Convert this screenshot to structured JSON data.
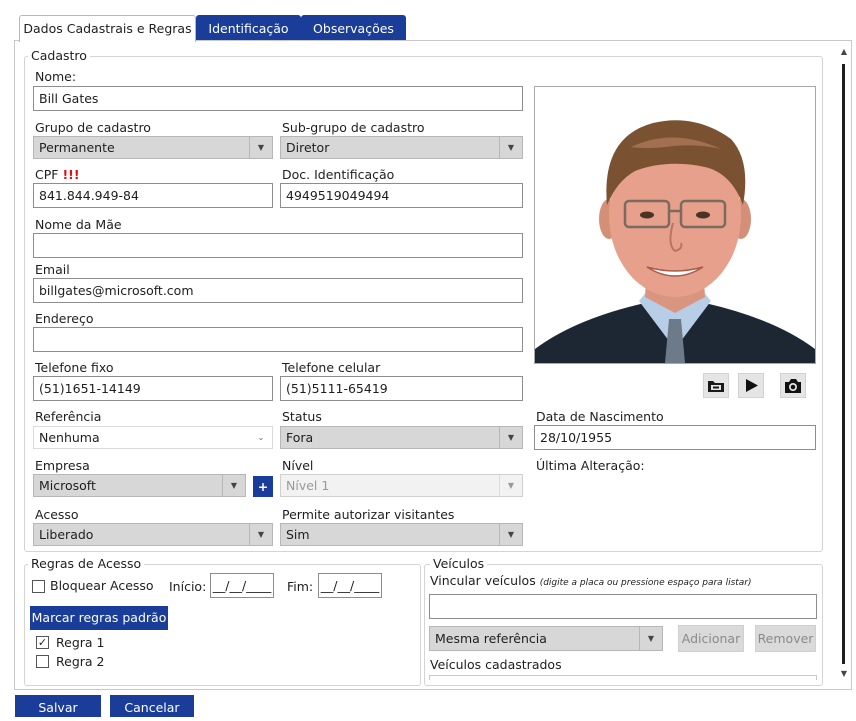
{
  "tabs": [
    {
      "label": "Dados Cadastrais e Regras",
      "active": true
    },
    {
      "label": "Identificação",
      "active": false
    },
    {
      "label": "Observações",
      "active": false
    }
  ],
  "cadastro": {
    "legend": "Cadastro",
    "nome": {
      "label": "Nome:",
      "value": "Bill Gates"
    },
    "grupo": {
      "label": "Grupo de cadastro",
      "value": "Permanente"
    },
    "subgrupo": {
      "label": "Sub-grupo de cadastro",
      "value": "Diretor"
    },
    "cpf": {
      "label": "CPF",
      "warning": "!!!",
      "value": "841.844.949-84"
    },
    "doc": {
      "label": "Doc. Identificação",
      "value": "4949519049494"
    },
    "mae": {
      "label": "Nome da Mãe",
      "value": ""
    },
    "email": {
      "label": "Email",
      "value": "billgates@microsoft.com"
    },
    "endereco": {
      "label": "Endereço",
      "value": ""
    },
    "tel_fixo": {
      "label": "Telefone fixo",
      "value": "(51)1651-14149"
    },
    "tel_cel": {
      "label": "Telefone celular",
      "value": "(51)5111-65419"
    },
    "referencia": {
      "label": "Referência",
      "value": "Nenhuma"
    },
    "status": {
      "label": "Status",
      "value": "Fora"
    },
    "empresa": {
      "label": "Empresa",
      "value": "Microsoft",
      "add_button": "+"
    },
    "nivel": {
      "label": "Nível",
      "value": "Nível 1"
    },
    "acesso": {
      "label": "Acesso",
      "value": "Liberado"
    },
    "visitantes": {
      "label": "Permite autorizar visitantes",
      "value": "Sim"
    },
    "nascimento": {
      "label": "Data de Nascimento",
      "value": "28/10/1955"
    },
    "ultima_alteracao": {
      "label": "Última Alteração:",
      "value": ""
    }
  },
  "photo_controls": [
    "open-folder-icon",
    "play-icon",
    "camera-icon"
  ],
  "regras": {
    "legend": "Regras de Acesso",
    "bloquear": {
      "label": "Bloquear Acesso",
      "checked": false
    },
    "inicio": {
      "label": "Início:",
      "value": "__/__/____"
    },
    "fim": {
      "label": "Fim:",
      "value": "__/__/____"
    },
    "marcar_button": "Marcar regras padrão",
    "items": [
      {
        "label": "Regra 1",
        "checked": true
      },
      {
        "label": "Regra 2",
        "checked": false
      }
    ]
  },
  "veiculos": {
    "legend": "Veículos",
    "vincular_label": "Vincular veículos",
    "vincular_hint": "(digite a placa ou pressione espaço para listar)",
    "vincular_value": "",
    "referencia_value": "Mesma referência",
    "adicionar": "Adicionar",
    "remover": "Remover",
    "cadastrados_label": "Veículos cadastrados"
  },
  "footer": {
    "save": "Salvar",
    "cancel": "Cancelar"
  },
  "colors": {
    "accent": "#1a3d9a",
    "warning": "#e01010",
    "disabled": "#dadada"
  }
}
